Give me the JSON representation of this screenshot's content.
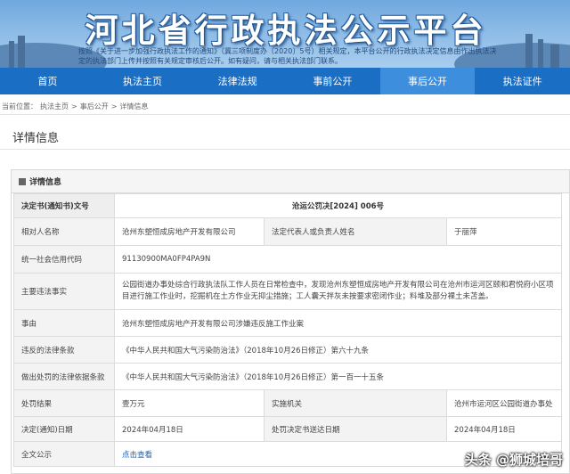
{
  "header": {
    "title": "河北省行政执法公示平台",
    "notice": "按照《关于进一步加强行政执法工作的通知》（冀三项制度办〔2020〕5号）相关规定，本平台公开的行政执法决定信息由作出执法决定的执法部门上传并按照有关规定审核后公开。如有疑问，请与相关执法部门联系。"
  },
  "nav": [
    {
      "label": "首页",
      "active": false
    },
    {
      "label": "执法主页",
      "active": false
    },
    {
      "label": "法律法规",
      "active": false
    },
    {
      "label": "事前公开",
      "active": false
    },
    {
      "label": "事后公开",
      "active": true
    },
    {
      "label": "执法证件",
      "active": false
    }
  ],
  "breadcrumb": {
    "prefix": "当前位置：",
    "items": [
      "执法主页",
      "事后公开",
      "详情信息"
    ],
    "separator": ">"
  },
  "section_title": "详情信息",
  "panel_title": "详情信息",
  "rows": {
    "decision_no": {
      "label": "决定书(通知书)文号",
      "value": "沧运公罚决[2024] 006号"
    },
    "party": {
      "label": "相对人名称",
      "value": "沧州东塑恒成房地产开发有限公司",
      "label2": "法定代表人或负责人姓名",
      "value2": "于丽萍"
    },
    "credit_code": {
      "label": "统一社会信用代码",
      "value": "91130900MA0FP4PA9N"
    },
    "violation": {
      "label": "主要违法事实",
      "value": "公园街道办事处综合行政执法队工作人员在日常检查中，发现沧州东塑恒成房地产开发有限公司在沧州市运河区颐和君悦府小区项目进行施工作业时，挖掘机在土方作业无抑尘措施；工人囊天拌灰未按要求密闭作业；料堆及部分裸土未苫盖。"
    },
    "subject": {
      "label": "事由",
      "value": "沧州东塑恒成房地产开发有限公司涉嫌违反施工作业案"
    },
    "law_violated": {
      "label": "违反的法律条款",
      "value": "《中华人民共和国大气污染防治法》（2018年10月26日修正）第六十九条"
    },
    "law_basis": {
      "label": "做出处罚的法律依据条款",
      "value": "《中华人民共和国大气污染防治法》（2018年10月26日修正）第一百一十五条"
    },
    "result": {
      "label": "处罚结果",
      "value": "壹万元",
      "label2": "实施机关",
      "value2": "沧州市运河区公园街道办事处"
    },
    "date": {
      "label": "决定(通知)日期",
      "value": "2024年04月18日",
      "label2": "处罚决定书送达日期",
      "value2": "2024年04月18日"
    },
    "fulltext": {
      "label": "全文公示",
      "value": "点击查看"
    }
  },
  "watermark": "头条 @狮城培哥",
  "colors": {
    "nav_bg": "#1a6fc4",
    "nav_active": "#3d8fde",
    "link": "#1a5fb4"
  }
}
